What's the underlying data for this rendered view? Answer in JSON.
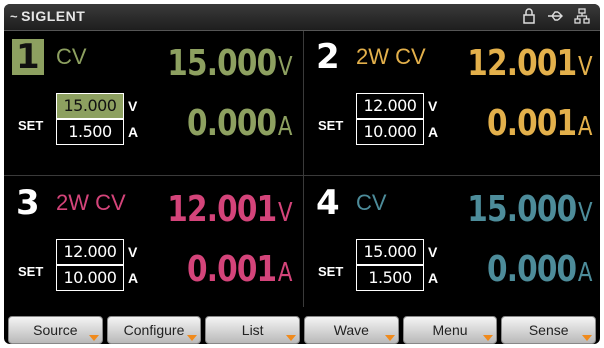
{
  "header": {
    "brand": "SIGLENT",
    "brand_mark": "~",
    "status_icons": [
      "lock-icon",
      "usb-icon",
      "lan-icon"
    ]
  },
  "colors": {
    "ch1": "#8da060",
    "ch2": "#e3b04b",
    "ch3": "#d4447a",
    "ch4": "#4d8c9a"
  },
  "channels": [
    {
      "number": "1",
      "mode": "CV",
      "voltage": "15.000",
      "voltage_unit": "V",
      "current": "0.000",
      "current_unit": "A",
      "set_label": "SET",
      "set_voltage": "15.000",
      "set_current": "1.500",
      "set_v_unit": "V",
      "set_a_unit": "A",
      "color": "#8da060"
    },
    {
      "number": "2",
      "mode": "2W CV",
      "voltage": "12.001",
      "voltage_unit": "V",
      "current": "0.001",
      "current_unit": "A",
      "set_label": "SET",
      "set_voltage": "12.000",
      "set_current": "10.000",
      "set_v_unit": "V",
      "set_a_unit": "A",
      "color": "#e3b04b"
    },
    {
      "number": "3",
      "mode": "2W CV",
      "voltage": "12.001",
      "voltage_unit": "V",
      "current": "0.001",
      "current_unit": "A",
      "set_label": "SET",
      "set_voltage": "12.000",
      "set_current": "10.000",
      "set_v_unit": "V",
      "set_a_unit": "A",
      "color": "#d4447a"
    },
    {
      "number": "4",
      "mode": "CV",
      "voltage": "15.000",
      "voltage_unit": "V",
      "current": "0.000",
      "current_unit": "A",
      "set_label": "SET",
      "set_voltage": "15.000",
      "set_current": "1.500",
      "set_v_unit": "V",
      "set_a_unit": "A",
      "color": "#4d8c9a"
    }
  ],
  "softkeys": [
    "Source",
    "Configure",
    "List",
    "Wave",
    "Menu",
    "Sense"
  ]
}
